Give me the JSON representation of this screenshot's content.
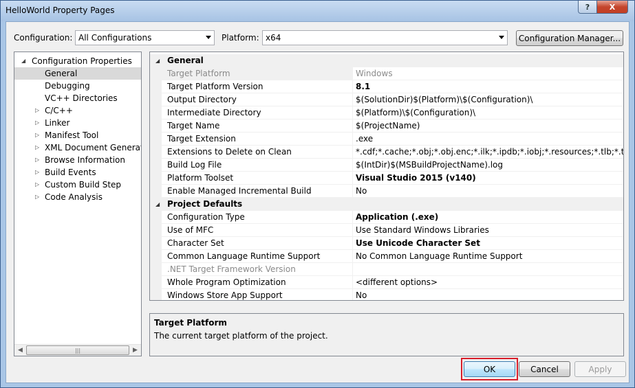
{
  "window": {
    "title": "HelloWorld Property Pages"
  },
  "titlebar": {
    "help_glyph": "?",
    "close_glyph": "X"
  },
  "top": {
    "configuration_label": "Configuration:",
    "configuration_value": "All Configurations",
    "platform_label": "Platform:",
    "platform_value": "x64",
    "config_manager_label": "Configuration Manager..."
  },
  "tree": {
    "items": [
      {
        "label": "Configuration Properties",
        "expander": "expanded"
      },
      {
        "label": "General",
        "selected": true
      },
      {
        "label": "Debugging"
      },
      {
        "label": "VC++ Directories"
      },
      {
        "label": "C/C++",
        "expander": "collapsed"
      },
      {
        "label": "Linker",
        "expander": "collapsed"
      },
      {
        "label": "Manifest Tool",
        "expander": "collapsed"
      },
      {
        "label": "XML Document Generator",
        "expander": "collapsed"
      },
      {
        "label": "Browse Information",
        "expander": "collapsed"
      },
      {
        "label": "Build Events",
        "expander": "collapsed"
      },
      {
        "label": "Custom Build Step",
        "expander": "collapsed"
      },
      {
        "label": "Code Analysis",
        "expander": "collapsed"
      }
    ]
  },
  "grid": {
    "general": {
      "label": "General",
      "rows": [
        {
          "name": "Target Platform",
          "value": "Windows",
          "grayed": true,
          "selected": true
        },
        {
          "name": "Target Platform Version",
          "value": "8.1",
          "bold": true
        },
        {
          "name": "Output Directory",
          "value": "$(SolutionDir)$(Platform)\\$(Configuration)\\"
        },
        {
          "name": "Intermediate Directory",
          "value": "$(Platform)\\$(Configuration)\\"
        },
        {
          "name": "Target Name",
          "value": "$(ProjectName)"
        },
        {
          "name": "Target Extension",
          "value": ".exe"
        },
        {
          "name": "Extensions to Delete on Clean",
          "value": "*.cdf;*.cache;*.obj;*.obj.enc;*.ilk;*.ipdb;*.iobj;*.resources;*.tlb;*.tli;*.tlh;*.tmp"
        },
        {
          "name": "Build Log File",
          "value": "$(IntDir)$(MSBuildProjectName).log"
        },
        {
          "name": "Platform Toolset",
          "value": "Visual Studio 2015 (v140)",
          "bold": true
        },
        {
          "name": "Enable Managed Incremental Build",
          "value": "No"
        }
      ]
    },
    "project_defaults": {
      "label": "Project Defaults",
      "rows": [
        {
          "name": "Configuration Type",
          "value": "Application (.exe)",
          "bold": true
        },
        {
          "name": "Use of MFC",
          "value": "Use Standard Windows Libraries"
        },
        {
          "name": "Character Set",
          "value": "Use Unicode Character Set",
          "bold": true
        },
        {
          "name": "Common Language Runtime Support",
          "value": "No Common Language Runtime Support"
        },
        {
          "name": ".NET Target Framework Version",
          "value": "",
          "grayed": true
        },
        {
          "name": "Whole Program Optimization",
          "value": "<different options>"
        },
        {
          "name": "Windows Store App Support",
          "value": "No"
        }
      ]
    }
  },
  "description": {
    "title": "Target Platform",
    "text": "The current target platform of the project."
  },
  "buttons": {
    "ok": "OK",
    "cancel": "Cancel",
    "apply": "Apply"
  },
  "colors": {
    "highlight": "#d81e2a",
    "selection": "#d9d9d9"
  }
}
